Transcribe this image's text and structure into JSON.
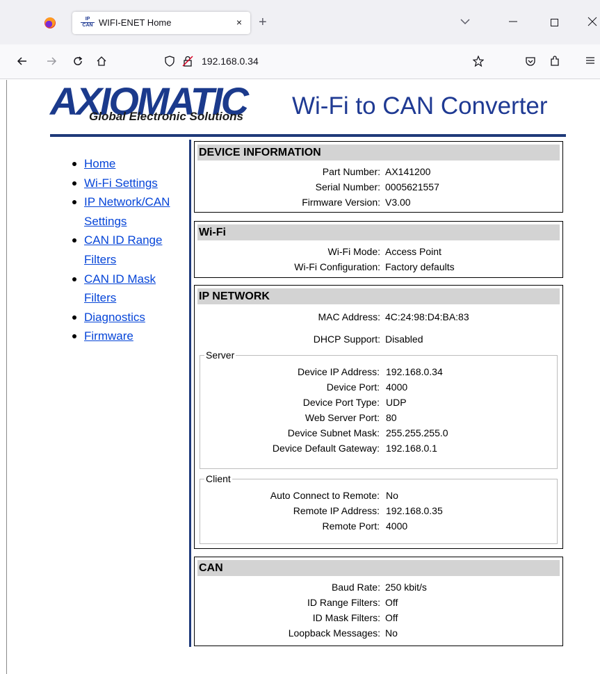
{
  "browser": {
    "tab_title": "WIFI-ENET Home",
    "tab_icon_text_top": "IP",
    "tab_icon_text_bottom": "CAN",
    "new_tab_label": "+",
    "close_tab_label": "×",
    "url": "192.168.0.34"
  },
  "header": {
    "logo_word": "AXIOMATIC",
    "logo_sub": "Global Electronic Solutions",
    "title": "Wi-Fi to CAN Converter"
  },
  "sidebar": {
    "items": [
      {
        "label": "Home"
      },
      {
        "label": "Wi-Fi Settings"
      },
      {
        "label_1": "IP Network/CAN",
        "label_2": "Settings"
      },
      {
        "label_1": "CAN ID Range",
        "label_2": "Filters"
      },
      {
        "label_1": "CAN ID Mask",
        "label_2": "Filters"
      },
      {
        "label": "Diagnostics"
      },
      {
        "label": "Firmware"
      }
    ]
  },
  "device_info": {
    "heading": "DEVICE INFORMATION",
    "rows": [
      {
        "k": "Part Number:",
        "v": "AX141200"
      },
      {
        "k": "Serial Number:",
        "v": "0005621557"
      },
      {
        "k": "Firmware Version:",
        "v": "V3.00"
      }
    ]
  },
  "wifi": {
    "heading": "Wi-Fi",
    "rows": [
      {
        "k": "Wi-Fi Mode:",
        "v": "Access Point"
      },
      {
        "k": "Wi-Fi Configuration:",
        "v": "Factory defaults"
      }
    ]
  },
  "ip_network": {
    "heading": "IP NETWORK",
    "rows": [
      {
        "k": "MAC Address:",
        "v": "4C:24:98:D4:BA:83"
      },
      {
        "k": "DHCP Support:",
        "v": "Disabled"
      }
    ],
    "server": {
      "legend": "Server",
      "rows": [
        {
          "k": "Device IP Address:",
          "v": "192.168.0.34"
        },
        {
          "k": "Device Port:",
          "v": "4000"
        },
        {
          "k": "Device Port Type:",
          "v": "UDP"
        },
        {
          "k": "Web Server Port:",
          "v": "80"
        },
        {
          "k": "Device Subnet Mask:",
          "v": "255.255.255.0"
        },
        {
          "k": "Device Default Gateway:",
          "v": "192.168.0.1"
        }
      ]
    },
    "client": {
      "legend": "Client",
      "rows": [
        {
          "k": "Auto Connect to Remote:",
          "v": "No"
        },
        {
          "k": "Remote IP Address:",
          "v": "192.168.0.35"
        },
        {
          "k": "Remote Port:",
          "v": "4000"
        }
      ]
    }
  },
  "can": {
    "heading": "CAN",
    "rows": [
      {
        "k": "Baud Rate:",
        "v": "250 kbit/s"
      },
      {
        "k": "ID Range Filters:",
        "v": "Off"
      },
      {
        "k": "ID Mask Filters:",
        "v": "Off"
      },
      {
        "k": "Loopback Messages:",
        "v": "No"
      }
    ]
  },
  "colors": {
    "brand_blue": "#1f3a93",
    "link_blue": "#0645d8",
    "panel_head_bg": "#d3d3d3"
  }
}
